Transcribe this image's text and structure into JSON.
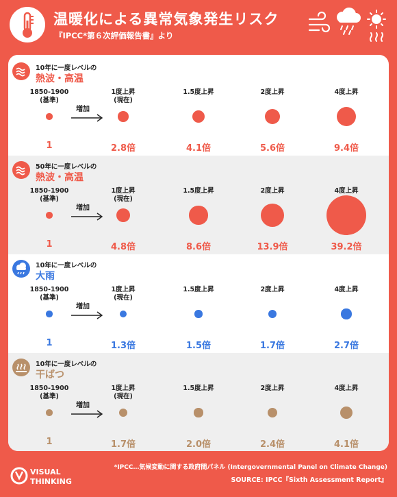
{
  "header": {
    "title": "温暖化による異常気象発生リスク",
    "subtitle": "『IPCC*第６次評価報告書』より"
  },
  "columns": {
    "baseline": "1850-1900",
    "baseline_sub": "(基準)",
    "increase_label": "増加",
    "levels": [
      {
        "label": "1度上昇",
        "sub": "(現在)"
      },
      {
        "label": "1.5度上昇",
        "sub": ""
      },
      {
        "label": "2度上昇",
        "sub": ""
      },
      {
        "label": "4度上昇",
        "sub": ""
      }
    ]
  },
  "chart_data": [
    {
      "type": "bubble",
      "subtitle": "10年に一度レベルの",
      "title": "熱波・高温",
      "color": "#ef5a4a",
      "categories": [
        "1850-1900",
        "1度上昇",
        "1.5度上昇",
        "2度上昇",
        "4度上昇"
      ],
      "values": [
        1,
        2.8,
        4.1,
        5.6,
        9.4
      ],
      "labels": [
        "1",
        "2.8倍",
        "4.1倍",
        "5.6倍",
        "9.4倍"
      ]
    },
    {
      "type": "bubble",
      "subtitle": "50年に一度レベルの",
      "title": "熱波・高温",
      "color": "#ef5a4a",
      "categories": [
        "1850-1900",
        "1度上昇",
        "1.5度上昇",
        "2度上昇",
        "4度上昇"
      ],
      "values": [
        1,
        4.8,
        8.6,
        13.9,
        39.2
      ],
      "labels": [
        "1",
        "4.8倍",
        "8.6倍",
        "13.9倍",
        "39.2倍"
      ]
    },
    {
      "type": "bubble",
      "subtitle": "10年に一度レベルの",
      "title": "大雨",
      "color": "#3a78e0",
      "categories": [
        "1850-1900",
        "1度上昇",
        "1.5度上昇",
        "2度上昇",
        "4度上昇"
      ],
      "values": [
        1,
        1.3,
        1.5,
        1.7,
        2.7
      ],
      "labels": [
        "1",
        "1.3倍",
        "1.5倍",
        "1.7倍",
        "2.7倍"
      ]
    },
    {
      "type": "bubble",
      "subtitle": "10年に一度レベルの",
      "title": "干ばつ",
      "color": "#b8906a",
      "categories": [
        "1850-1900",
        "1度上昇",
        "1.5度上昇",
        "2度上昇",
        "4度上昇"
      ],
      "values": [
        1,
        1.7,
        2.0,
        2.4,
        4.1
      ],
      "labels": [
        "1",
        "1.7倍",
        "2.0倍",
        "2.4倍",
        "4.1倍"
      ]
    }
  ],
  "footer": {
    "logo_line1": "VISUAL",
    "logo_line2": "THINKING",
    "note": "*IPCC…気候変動に関する政府間パネル (Intergovernmental Panel on Climate Change)",
    "source": "SOURCE: IPCC『Sixth Assessment Report』"
  },
  "icons": {
    "header_left": "thermometer-icon",
    "header_right": [
      "wind-icon",
      "rain-cloud-icon",
      "sun-heat-icon"
    ],
    "sections": [
      "heat-icon",
      "heat-icon",
      "rain-icon",
      "drought-icon"
    ]
  },
  "colors": {
    "background": "#ef5a4a",
    "heat": "#ef5a4a",
    "rain": "#3a78e0",
    "drought": "#b8906a"
  }
}
